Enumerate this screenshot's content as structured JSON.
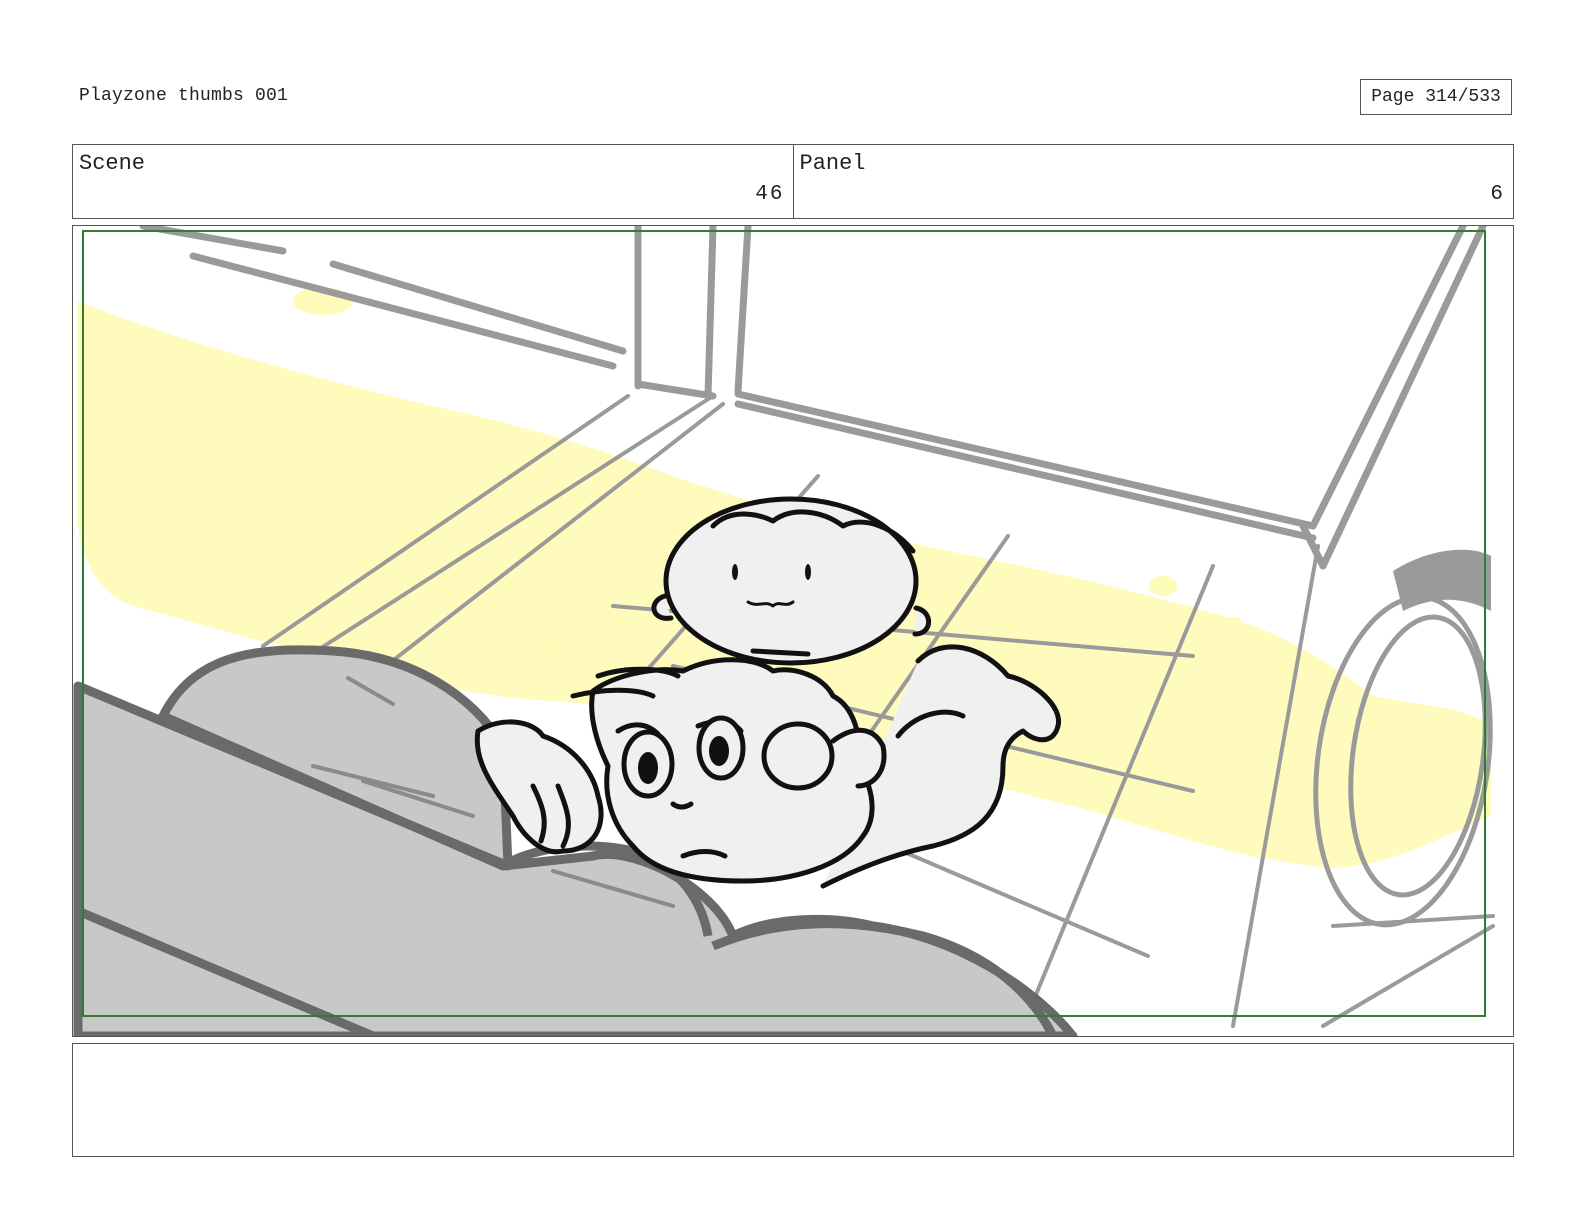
{
  "header": {
    "title": "Playzone thumbs 001",
    "page_label": "Page 314/533"
  },
  "info": {
    "scene_label": "Scene",
    "scene_value": "46",
    "panel_label": "Panel",
    "panel_value": "6"
  },
  "notes": {
    "text": ""
  },
  "colors": {
    "safe_frame": "#2e7d32",
    "yellow_wash": "#fffbb8",
    "sketch_gray": "#9a9a9a",
    "dark_gray": "#6a6a6a",
    "fill_gray": "#c8c8c8",
    "ink": "#111111"
  }
}
